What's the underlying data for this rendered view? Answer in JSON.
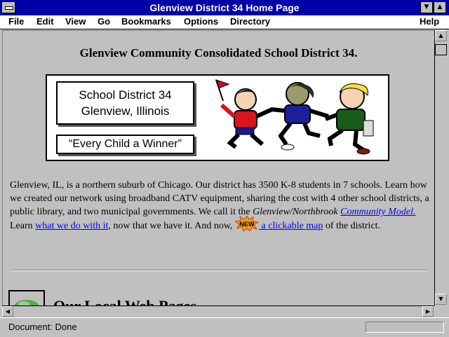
{
  "window": {
    "title": "Glenview District 34 Home Page"
  },
  "menu": {
    "items": [
      "File",
      "Edit",
      "View",
      "Go",
      "Bookmarks",
      "Options",
      "Directory",
      "Help"
    ]
  },
  "page": {
    "heading": "Glenview Community Consolidated School District 34.",
    "banner": {
      "line1": "School District 34",
      "line2": "Glenview, Illinois",
      "motto": "“Every Child a Winner”"
    },
    "intro_pre": "Glenview, IL, is a northern suburb of Chicago. Our district has 3500 K-8 students in 7 schools. Learn how we created our network using broadband CATV equipment, sharing the cost with 4 other school districts, a public library, and two municipal governments. We call it the ",
    "intro_italic": "Glenview/Northbrook",
    "link_community": "Community Model.",
    "intro_mid": " Learn ",
    "link_what": "what we do with it",
    "intro_mid2": ", now that we have it. And now, ",
    "new_badge": "NEW",
    "link_map": " a clickable map",
    "intro_end": " of the district.",
    "section_heading": "Our Local Web Pages"
  },
  "status": {
    "text": "Document: Done"
  },
  "colors": {
    "titlebar": "#0000a8",
    "link": "#0000ee",
    "background": "#c0c0c0"
  }
}
